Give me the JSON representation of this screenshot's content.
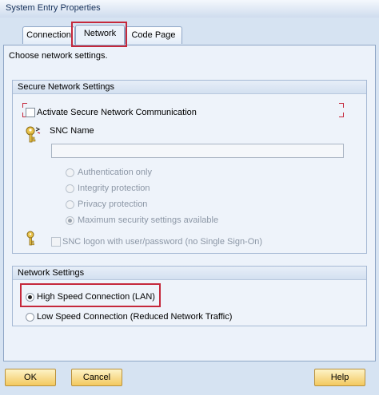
{
  "window": {
    "title": "System Entry Properties"
  },
  "tabs": [
    {
      "label": "Connection"
    },
    {
      "label": "Network"
    },
    {
      "label": "Code Page"
    }
  ],
  "description": "Choose network settings.",
  "secure_group": {
    "title": "Secure Network Settings",
    "activate_label": "Activate Secure Network Communication",
    "activate_checked": false,
    "snc_name_label": "SNC Name",
    "snc_name_value": "",
    "options": [
      {
        "label": "Authentication only",
        "selected": false
      },
      {
        "label": "Integrity protection",
        "selected": false
      },
      {
        "label": "Privacy protection",
        "selected": false
      },
      {
        "label": "Maximum security settings available",
        "selected": true
      }
    ],
    "snc_logon_label": "SNC logon with user/password (no Single Sign-On)",
    "snc_logon_checked": false
  },
  "network_group": {
    "title": "Network Settings",
    "options": [
      {
        "label": "High Speed Connection (LAN)",
        "selected": true
      },
      {
        "label": "Low Speed Connection (Reduced Network Traffic)",
        "selected": false
      }
    ]
  },
  "buttons": {
    "ok": "OK",
    "cancel": "Cancel",
    "help": "Help"
  }
}
